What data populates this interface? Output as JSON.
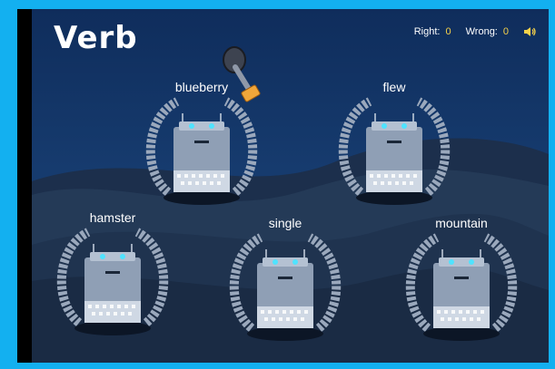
{
  "title": "Verb",
  "score": {
    "right_label": "Right:",
    "right_value": "0",
    "wrong_label": "Wrong:",
    "wrong_value": "0"
  },
  "icons": {
    "sound": "speaker-icon",
    "tool": "hammer-icon"
  },
  "moles": [
    {
      "word": "blueberry"
    },
    {
      "word": "flew"
    },
    {
      "word": "hamster"
    },
    {
      "word": "single"
    },
    {
      "word": "mountain"
    }
  ],
  "colors": {
    "frame": "#13b0f0",
    "sky": "#0f2d5c",
    "score_value": "#f6d24a",
    "robot_body": "#8f9fb5",
    "robot_light": "#4fe3ff"
  }
}
